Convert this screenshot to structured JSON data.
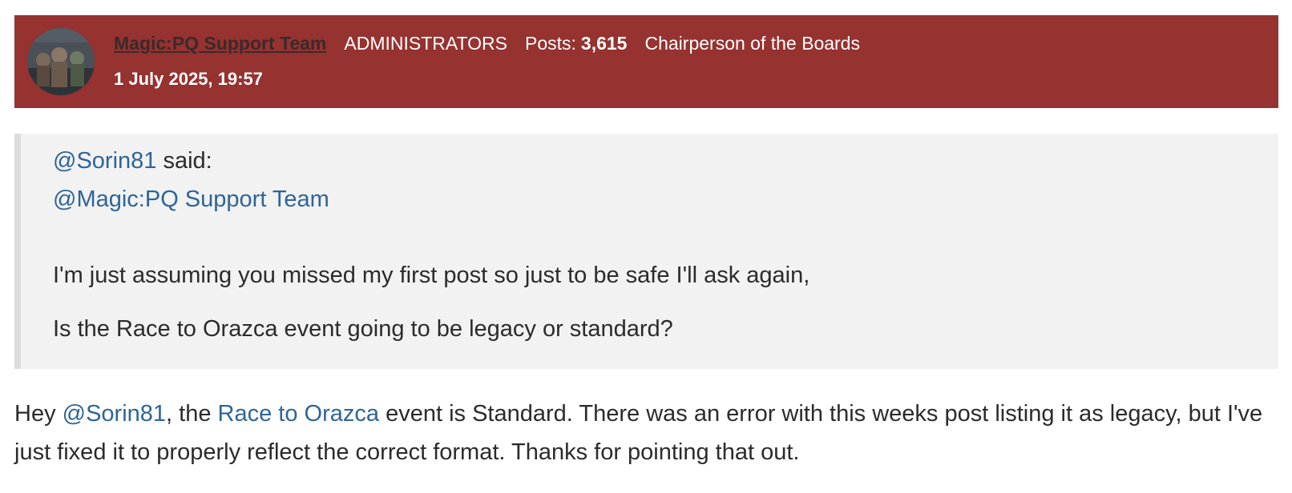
{
  "header": {
    "username": "Magic:PQ Support Team",
    "group": "ADMINISTRATORS",
    "posts_label": "Posts:",
    "posts_count": "3,615",
    "title_badge": "Chairperson of the Boards",
    "timestamp": "1 July 2025, 19:57",
    "color": "#963230"
  },
  "quote": {
    "author_mention": "@Sorin81",
    "said": " said:",
    "line_mention": "@Magic:PQ Support Team",
    "paragraph1": "I'm just assuming you missed my first post so just to be safe I'll ask again,",
    "paragraph2": "Is the Race to Orazca event going to be legacy or standard?"
  },
  "reply": {
    "part1": "Hey ",
    "mention": "@Sorin81",
    "part2": ", the ",
    "event_link": "Race to Orazca",
    "part3": " event is Standard. There was an error with this weeks post listing it as legacy, but I've just fixed it to properly reflect the correct format. Thanks for pointing that out."
  },
  "colors": {
    "link": "#2e6597",
    "quote_bg": "#f2f2f2"
  }
}
